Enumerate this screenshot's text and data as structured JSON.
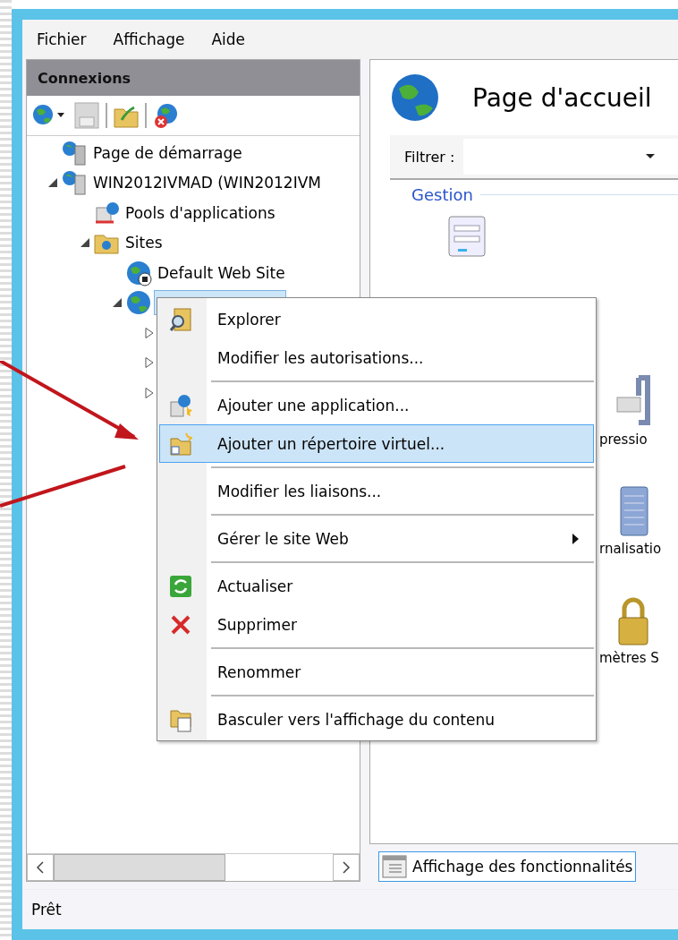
{
  "menu_bar": [
    "Fichier",
    "Affichage",
    "Aide"
  ],
  "connections": {
    "title": "Connexions",
    "tree": [
      {
        "label": "Page de démarrage",
        "kind": "start",
        "selected": false
      },
      {
        "label": "WIN2012IVMAD (WIN2012IVM",
        "kind": "server",
        "expanded": true,
        "selected": false,
        "children": [
          {
            "label": "Pools d'applications",
            "kind": "pools",
            "selected": false
          },
          {
            "label": "Sites",
            "kind": "sites",
            "expanded": true,
            "selected": false,
            "children": [
              {
                "label": "Default Web Site",
                "kind": "site",
                "stopped": true,
                "selected": false
              },
              {
                "kind": "site",
                "stopped": false,
                "expanded": true,
                "selected": true,
                "children": [
                  {
                    "expanded": false,
                    "selected": false
                  },
                  {
                    "expanded": false,
                    "selected": false
                  },
                  {
                    "expanded": false,
                    "selected": false
                  }
                ]
              }
            ]
          }
        ]
      }
    ]
  },
  "home": {
    "title": "Page d'accueil",
    "filter_label": "Filtrer :",
    "group": "Gestion",
    "features": [
      {
        "kind": "editor"
      },
      {
        "label": "pressio",
        "kind": "clamp"
      },
      {
        "label": "rnalisatio",
        "kind": "notebook"
      },
      {
        "label": "mètres S",
        "kind": "lock"
      }
    ],
    "view_tab": {
      "label": "Affichage des fonctionnalités",
      "selected": true
    }
  },
  "status_bar": "Prêt",
  "context_menu": [
    {
      "kind": "item",
      "label": "Explorer",
      "selected": false,
      "submenu": false
    },
    {
      "kind": "item",
      "label": "Modifier les autorisations...",
      "selected": false,
      "submenu": false
    },
    {
      "kind": "separator"
    },
    {
      "kind": "item",
      "label": "Ajouter une application...",
      "selected": false,
      "submenu": false
    },
    {
      "kind": "item",
      "label": "Ajouter un répertoire virtuel...",
      "selected": true,
      "submenu": false
    },
    {
      "kind": "separator"
    },
    {
      "kind": "item",
      "label": "Modifier les liaisons...",
      "selected": false,
      "submenu": false
    },
    {
      "kind": "separator"
    },
    {
      "kind": "item",
      "label": "Gérer le site Web",
      "selected": false,
      "submenu": true
    },
    {
      "kind": "separator"
    },
    {
      "kind": "item",
      "label": "Actualiser",
      "selected": false,
      "submenu": false
    },
    {
      "kind": "item",
      "label": "Supprimer",
      "selected": false,
      "submenu": false
    },
    {
      "kind": "separator"
    },
    {
      "kind": "item",
      "label": "Renommer",
      "selected": false,
      "submenu": false
    },
    {
      "kind": "separator"
    },
    {
      "kind": "item",
      "label": "Basculer vers l'affichage du contenu",
      "selected": false,
      "submenu": false
    }
  ]
}
